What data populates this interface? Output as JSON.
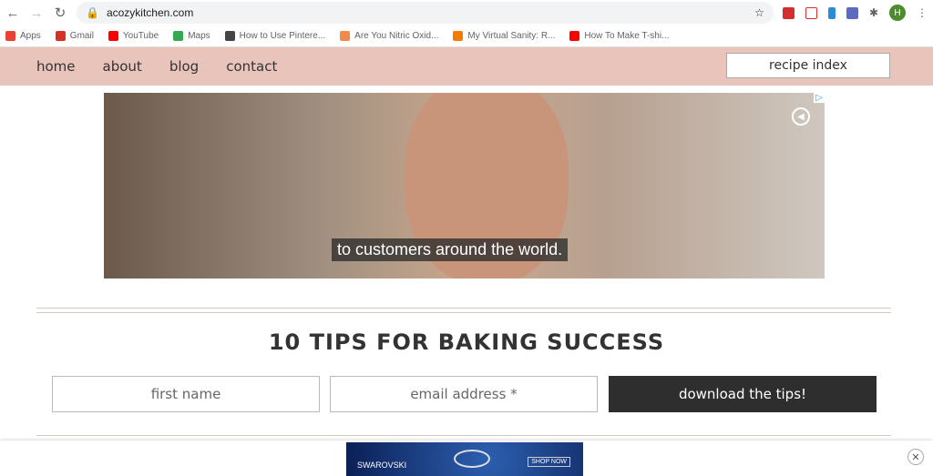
{
  "browser": {
    "url": "acozykitchen.com",
    "bookmarks": [
      {
        "label": "Apps",
        "color": "#e94235"
      },
      {
        "label": "Gmail",
        "color": "#d93025"
      },
      {
        "label": "YouTube",
        "color": "#ff0000"
      },
      {
        "label": "Maps",
        "color": "#34a853"
      },
      {
        "label": "How to Use Pintere...",
        "color": "#444444"
      },
      {
        "label": "Are You Nitric Oxid...",
        "color": "#f08a4b"
      },
      {
        "label": "My Virtual Sanity: R...",
        "color": "#f57c00"
      },
      {
        "label": "How To Make T-shi...",
        "color": "#ff0000"
      }
    ],
    "profile_initial": "H"
  },
  "site": {
    "nav": [
      "home",
      "about",
      "blog",
      "contact"
    ],
    "recipe_index": "recipe index"
  },
  "video_ad": {
    "caption": "to customers around the world."
  },
  "signup": {
    "title": "10 TIPS FOR BAKING SUCCESS",
    "first_name_placeholder": "first name",
    "email_placeholder": "email address *",
    "button": "download the tips!"
  },
  "bottom_ad": {
    "brand": "SWAROVSKI",
    "cta": "SHOP NOW"
  }
}
